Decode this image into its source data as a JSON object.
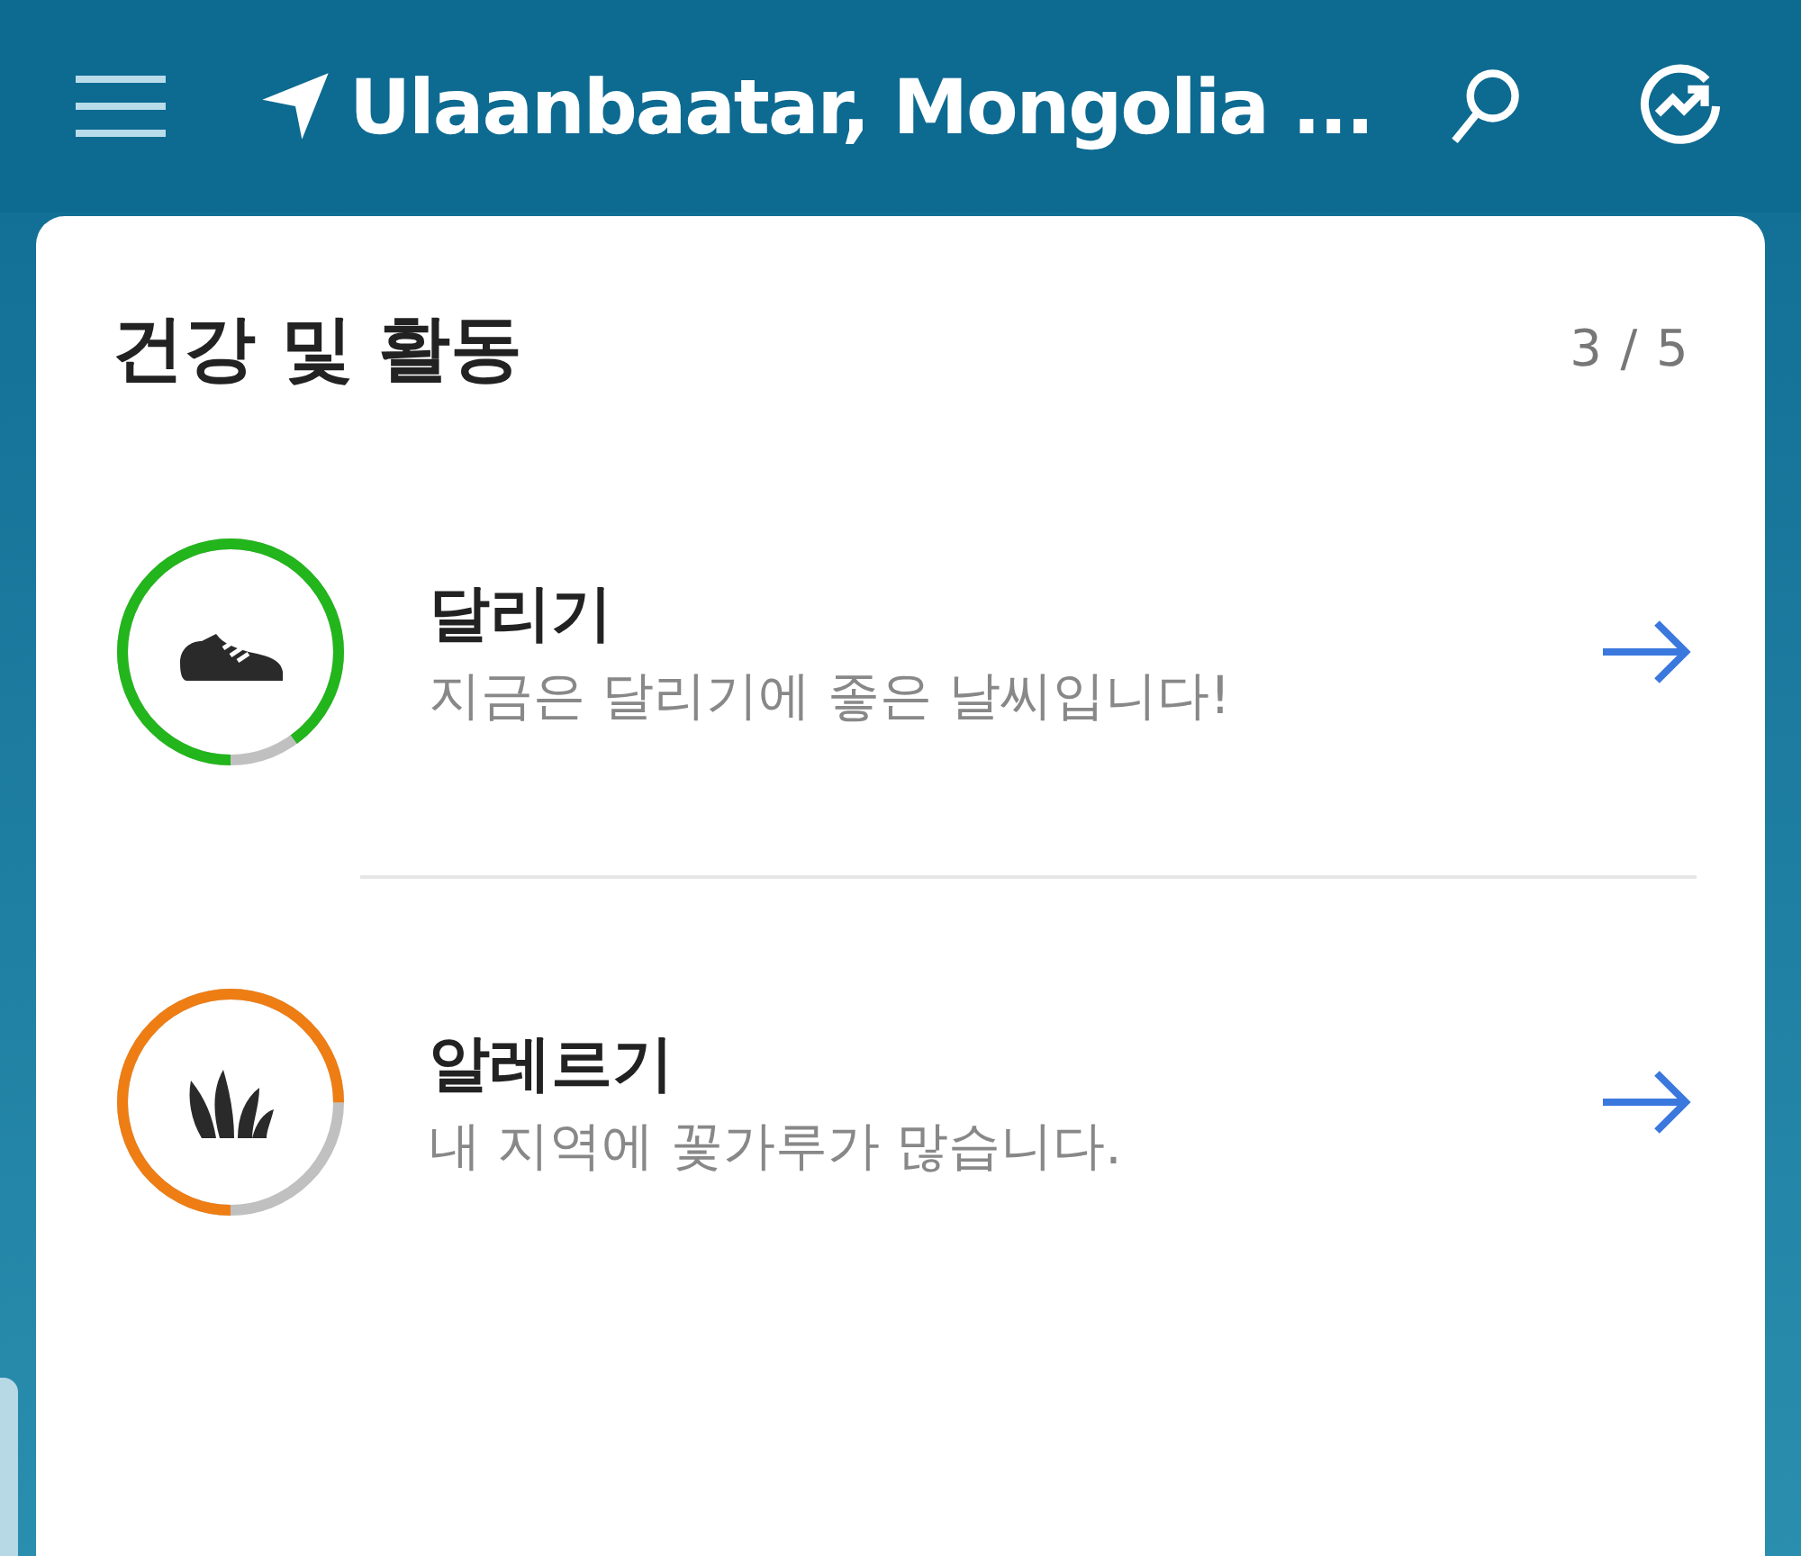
{
  "header": {
    "location": "Ulaanbaatar, Mongolia ..."
  },
  "card": {
    "title": "건강 및 활동",
    "page": "3 / 5",
    "items": [
      {
        "kind": "running",
        "title": "달리기",
        "subtitle": "지금은 달리기에 좋은 날씨입니다!",
        "color": "#22b51c"
      },
      {
        "kind": "allergy",
        "title": "알레르기",
        "subtitle": "내 지역에 꽃가루가 많습니다.",
        "color": "#ee7d13"
      }
    ]
  }
}
